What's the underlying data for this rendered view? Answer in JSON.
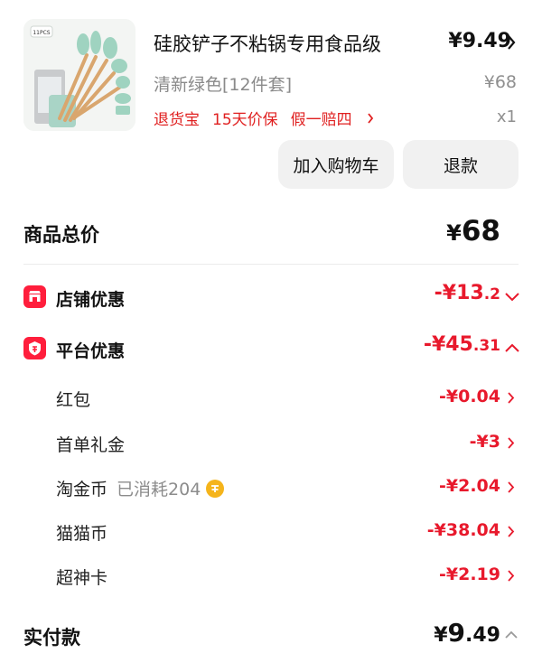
{
  "product": {
    "title": "硅胶铲子不粘锅专用食品级",
    "price": "¥9.49",
    "spec": "清新绿色[12件套]",
    "original_price": "¥68",
    "services": [
      "退货宝",
      "15天价保",
      "假一赔四"
    ],
    "quantity": "x1",
    "thumbnail_badge": "11PCS"
  },
  "actions": {
    "add_to_cart": "加入购物车",
    "refund": "退款"
  },
  "summary": {
    "total_label": "商品总价",
    "total_yen": "¥",
    "total_amount": "68"
  },
  "discounts": {
    "store": {
      "label": "店铺优惠",
      "prefix": "-¥13",
      "suffix": ".2",
      "expanded": false
    },
    "platform": {
      "label": "平台优惠",
      "prefix": "-¥45",
      "suffix": ".31",
      "expanded": true
    }
  },
  "platform_items": [
    {
      "label": "红包",
      "note": "",
      "value": "-¥0.04"
    },
    {
      "label": "首单礼金",
      "note": "",
      "value": "-¥3"
    },
    {
      "label": "淘金币",
      "note": "已消耗204",
      "value": "-¥2.04"
    },
    {
      "label": "猫猫币",
      "note": "",
      "value": "-¥38.04"
    },
    {
      "label": "超神卡",
      "note": "",
      "value": "-¥2.19"
    }
  ],
  "payment": {
    "label": "实付款",
    "yen": "¥",
    "main": "9",
    "decimal": ".49"
  },
  "colors": {
    "accent_red": "#e8192c",
    "badge_red": "#ff1e3c",
    "coin_gold": "#f5b41b",
    "button_bg": "#f1f1f1"
  }
}
